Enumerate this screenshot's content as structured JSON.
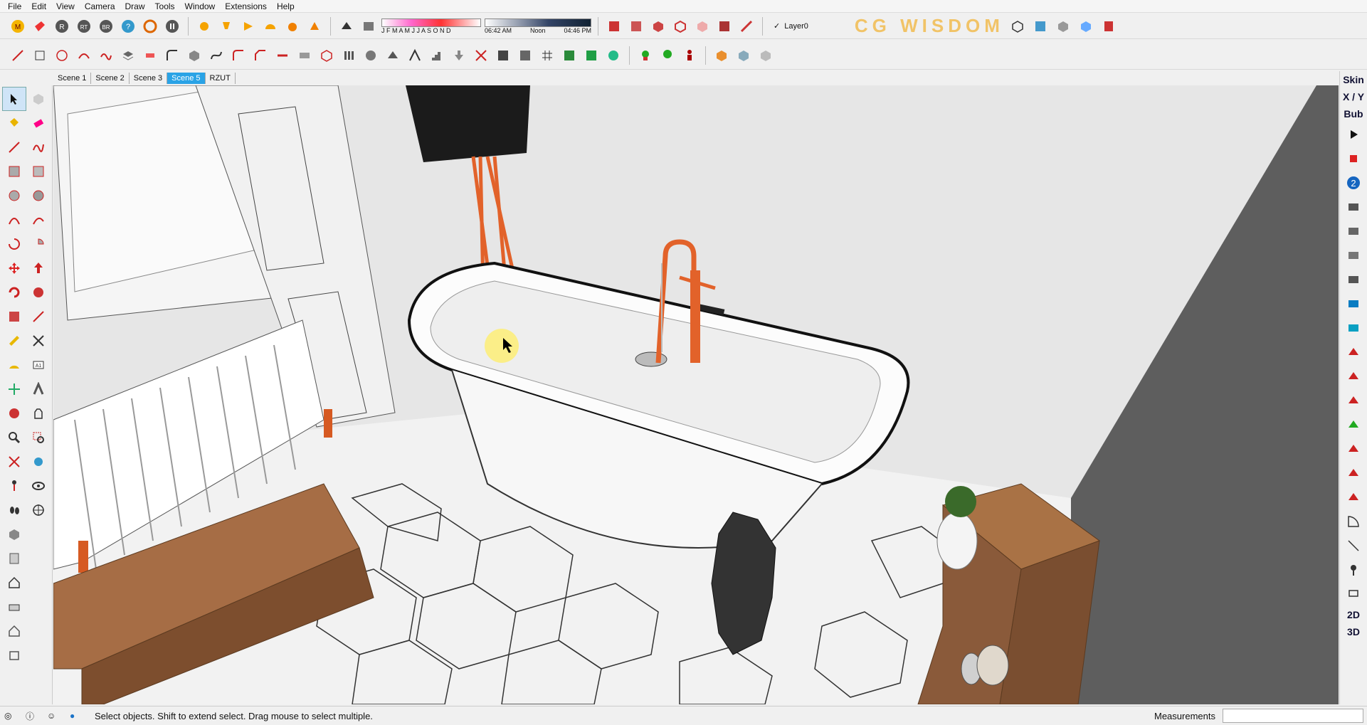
{
  "menu": [
    "File",
    "Edit",
    "View",
    "Camera",
    "Draw",
    "Tools",
    "Window",
    "Extensions",
    "Help"
  ],
  "shadow": {
    "months": "J F M A M J J A S O N D",
    "time_start": "06:42 AM",
    "time_mid": "Noon",
    "time_end": "04:46 PM"
  },
  "layer": {
    "name": "Layer0",
    "checked": true
  },
  "watermark": "CG WISDOM",
  "scenes": {
    "tabs": [
      "Scene 1",
      "Scene 2",
      "Scene 3",
      "Scene 5",
      "RZUT"
    ],
    "active": "Scene 5"
  },
  "right_labels": [
    "Skin",
    "X / Y",
    "Bub",
    "2D",
    "3D"
  ],
  "status": {
    "message": "Select objects. Shift to extend select. Drag mouse to select multiple.",
    "measurements_label": "Measurements",
    "measurements_value": ""
  },
  "colors": {
    "accent": "#2aa3e6",
    "faucet": "#e2622a",
    "wood": "#8a5a3a",
    "wall_dark": "#555555"
  }
}
